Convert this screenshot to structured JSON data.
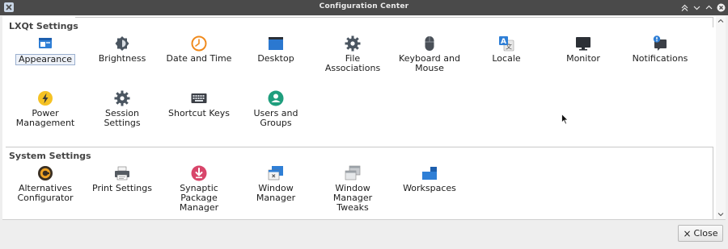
{
  "window": {
    "title": "Configuration Center"
  },
  "lxqt": {
    "title": "LXQt Settings",
    "items": [
      {
        "label": "Appearance",
        "icon": "appearance-icon"
      },
      {
        "label": "Brightness",
        "icon": "brightness-icon"
      },
      {
        "label": "Date and Time",
        "icon": "clock-icon"
      },
      {
        "label": "Desktop",
        "icon": "desktop-icon"
      },
      {
        "label": "File Associations",
        "icon": "gear-icon"
      },
      {
        "label": "Keyboard and Mouse",
        "icon": "mouse-icon"
      },
      {
        "label": "Locale",
        "icon": "locale-icon"
      },
      {
        "label": "Monitor",
        "icon": "monitor-icon"
      },
      {
        "label": "Notifications",
        "icon": "notification-icon"
      },
      {
        "label": "Power Management",
        "icon": "power-icon"
      },
      {
        "label": "Session Settings",
        "icon": "gear-icon"
      },
      {
        "label": "Shortcut Keys",
        "icon": "keyboard-icon"
      },
      {
        "label": "Users and Groups",
        "icon": "user-icon"
      }
    ]
  },
  "system": {
    "title": "System Settings",
    "items": [
      {
        "label": "Alternatives Configurator",
        "icon": "alternatives-icon"
      },
      {
        "label": "Print Settings",
        "icon": "printer-icon"
      },
      {
        "label": "Synaptic Package Manager",
        "icon": "package-icon"
      },
      {
        "label": "Window Manager",
        "icon": "window-manager-icon"
      },
      {
        "label": "Window Manager Tweaks",
        "icon": "window-tweaks-icon"
      },
      {
        "label": "Workspaces",
        "icon": "workspaces-icon"
      }
    ]
  },
  "footer": {
    "close_label": "Close"
  },
  "colors": {
    "titlebar": "#4a4a4a",
    "accent": "#3d8ee6",
    "selection_border": "#9bb0cf"
  }
}
